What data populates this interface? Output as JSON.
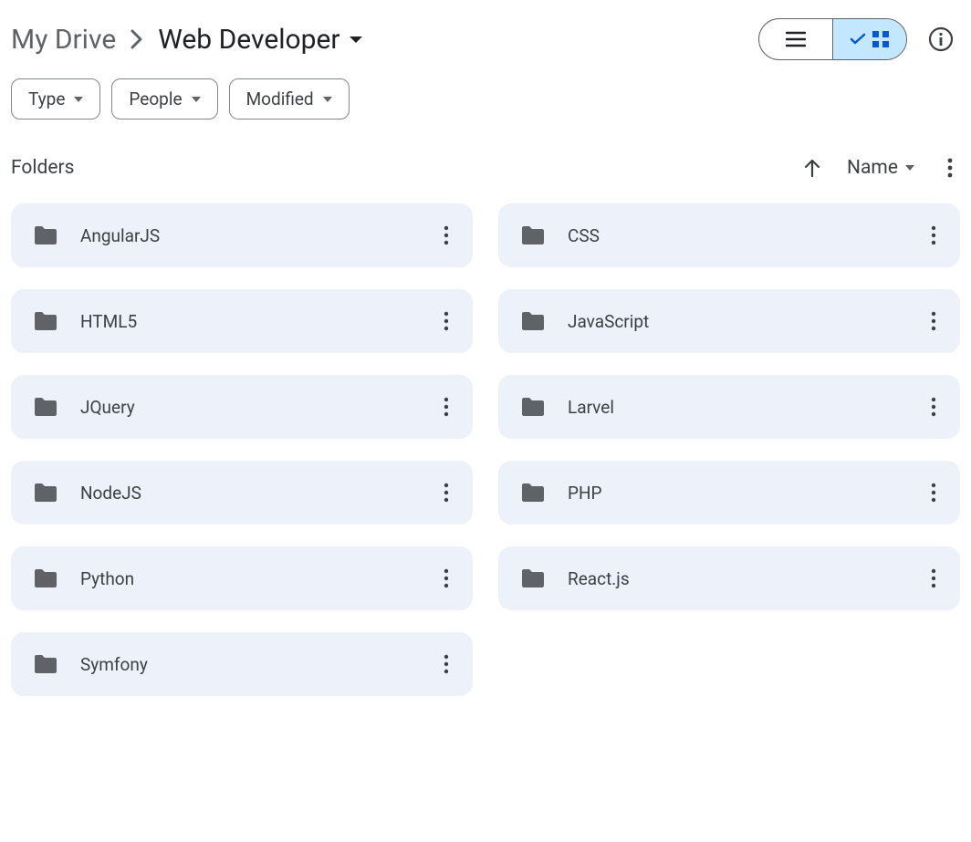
{
  "breadcrumb": {
    "root": "My Drive",
    "current": "Web Developer"
  },
  "filters": [
    {
      "label": "Type"
    },
    {
      "label": "People"
    },
    {
      "label": "Modified"
    }
  ],
  "section": {
    "title": "Folders",
    "sort_field": "Name"
  },
  "folders": [
    {
      "name": "AngularJS"
    },
    {
      "name": "CSS"
    },
    {
      "name": "HTML5"
    },
    {
      "name": "JavaScript"
    },
    {
      "name": "JQuery"
    },
    {
      "name": "Larvel"
    },
    {
      "name": "NodeJS"
    },
    {
      "name": "PHP"
    },
    {
      "name": "Python"
    },
    {
      "name": "React.js"
    },
    {
      "name": "Symfony"
    }
  ]
}
